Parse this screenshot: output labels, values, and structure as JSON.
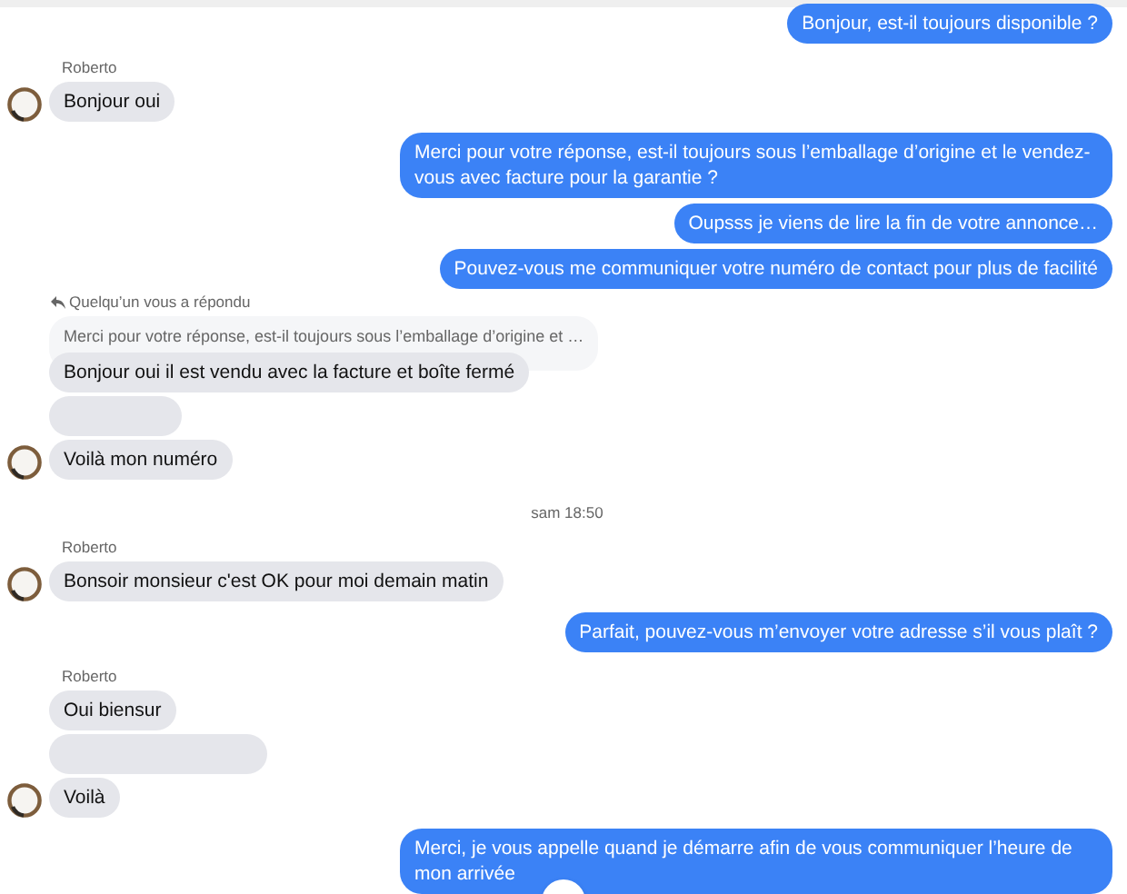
{
  "messages": [
    {
      "kind": "sent",
      "text": "Bonjour, est-il toujours disponible ?"
    },
    {
      "kind": "sender_name",
      "text": "Roberto"
    },
    {
      "kind": "received",
      "text": "Bonjour oui",
      "avatar": true
    },
    {
      "kind": "sent",
      "text": "Merci pour votre réponse, est-il toujours sous l’emballage d’origine et le vendez-vous avec facture pour la garantie ?"
    },
    {
      "kind": "sent",
      "text": "Oupsss je viens de lire la fin de votre annonce…"
    },
    {
      "kind": "sent",
      "text": "Pouvez-vous me communiquer votre numéro de contact pour plus de facilité"
    },
    {
      "kind": "reply_header",
      "text": "Quelqu’un vous a répondu"
    },
    {
      "kind": "quote",
      "text": "Merci pour votre réponse, est-il toujours sous l’emballage d’origine et …"
    },
    {
      "kind": "received",
      "text": "Bonjour oui il est vendu avec la facture et boîte fermé",
      "avatar": false
    },
    {
      "kind": "blank",
      "avatar": false
    },
    {
      "kind": "received",
      "text": "Voilà mon numéro",
      "avatar": true
    },
    {
      "kind": "timestamp",
      "text": "sam 18:50"
    },
    {
      "kind": "sender_name",
      "text": "Roberto"
    },
    {
      "kind": "received",
      "text": "Bonsoir monsieur c'est OK pour moi demain matin",
      "avatar": true
    },
    {
      "kind": "sent",
      "text": "Parfait, pouvez-vous m’envoyer votre adresse s’il vous plaît ?"
    },
    {
      "kind": "sender_name",
      "text": "Roberto"
    },
    {
      "kind": "received",
      "text": "Oui biensur",
      "avatar": false
    },
    {
      "kind": "blank",
      "avatar": false
    },
    {
      "kind": "received",
      "text": "Voilà",
      "avatar": true
    },
    {
      "kind": "sent",
      "text": "Merci, je vous appelle quand je démarre afin de vous communiquer l’heure de mon arrivée"
    }
  ]
}
